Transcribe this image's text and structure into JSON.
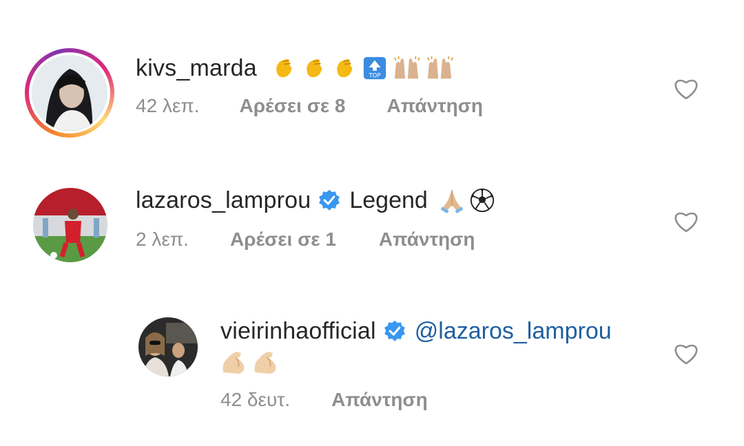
{
  "comments": [
    {
      "username": "kivs_marda",
      "text": "",
      "emojis": [
        "clapping-hands",
        "clapping-hands",
        "clapping-hands",
        "top-arrow",
        "raising-hands",
        "raising-hands"
      ],
      "time": "42 λεπ.",
      "likes": "Αρέσει σε 8",
      "reply": "Απάντηση",
      "has_story_ring": true,
      "verified": false
    },
    {
      "username": "lazaros_lamprou",
      "text": "Legend",
      "emojis": [
        "folded-hands",
        "soccer-ball"
      ],
      "time": "2 λεπ.",
      "likes": "Αρέσει σε 1",
      "reply": "Απάντηση",
      "has_story_ring": false,
      "verified": true
    },
    {
      "username": "vieirinhaofficial",
      "mention": "@lazaros_lamprou",
      "emojis": [
        "flexed-biceps",
        "flexed-biceps"
      ],
      "time": "42 δευτ.",
      "reply": "Απάντηση",
      "has_story_ring": false,
      "verified": true,
      "is_reply": true
    }
  ],
  "colors": {
    "text": "#262626",
    "meta": "#8e8e8e",
    "mention": "#1f5fa0",
    "verified": "#3897f0"
  }
}
